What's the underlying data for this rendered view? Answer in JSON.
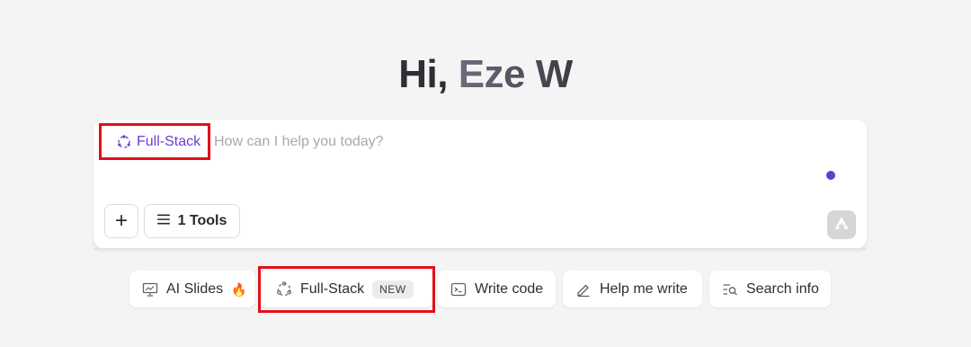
{
  "greeting": {
    "hi": "Hi, ",
    "name": "Eze W"
  },
  "composer": {
    "mode_label": "Full-Stack",
    "mode_icon": "full-stack-icon",
    "placeholder": "How can I help you today?",
    "value": "",
    "plus_label": "+",
    "tools_label": "1 Tools",
    "tools_icon": "menu-lines-icon",
    "send_icon": "send-logo-icon",
    "status_dot_color": "#5b3fd3",
    "mode_color": "#6b3fd1"
  },
  "quick_actions": [
    {
      "label": "AI Slides",
      "icon": "slides-icon",
      "suffix": "🔥"
    },
    {
      "label": "Full-Stack",
      "icon": "full-stack-icon",
      "badge": "NEW"
    },
    {
      "label": "Write code",
      "icon": "terminal-icon"
    },
    {
      "label": "Help me write",
      "icon": "pen-icon"
    },
    {
      "label": "Search info",
      "icon": "search-list-icon"
    }
  ],
  "annotation_color": "#e0101a"
}
